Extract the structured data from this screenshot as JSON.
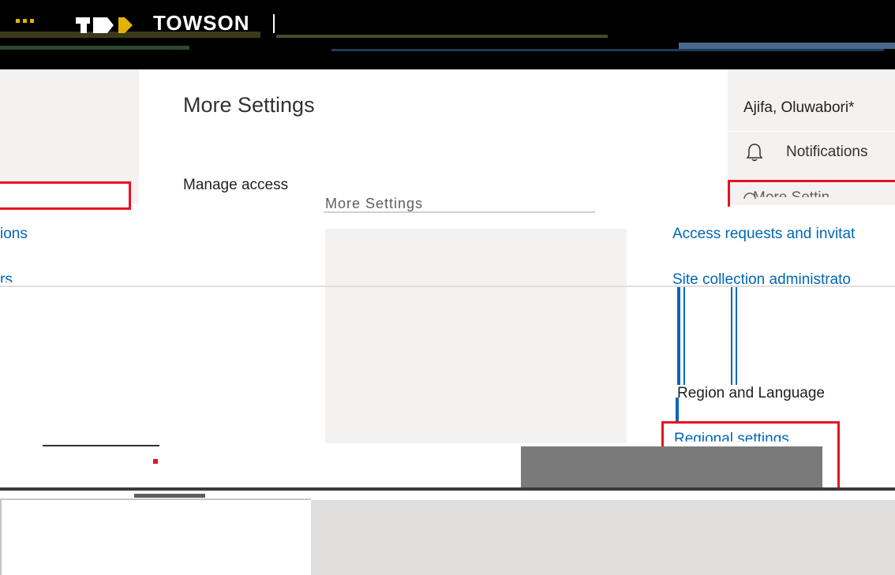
{
  "header": {
    "brand": "TOWSON"
  },
  "page": {
    "title": "More Settings"
  },
  "manage_access": {
    "heading": "Manage access",
    "left_links": [
      "ions",
      "rs"
    ],
    "right_links": [
      "Access requests and invitat",
      "Site collection administrato"
    ]
  },
  "breadcrumb_overlay": "More Settings",
  "region": {
    "heading": "Region and Language",
    "link": "Regional settings"
  },
  "account_panel": {
    "user_name": "Ajifa, Oluwabori*",
    "notifications_label": "Notifications",
    "more_settings_label": "More Settin"
  },
  "colors": {
    "accent_link": "#0067b8",
    "highlight": "#e81123",
    "brand_gold": "#e0b400"
  },
  "icons": {
    "bell": "bell-icon",
    "gear": "gear-icon",
    "waffle": "app-launcher-icon"
  }
}
